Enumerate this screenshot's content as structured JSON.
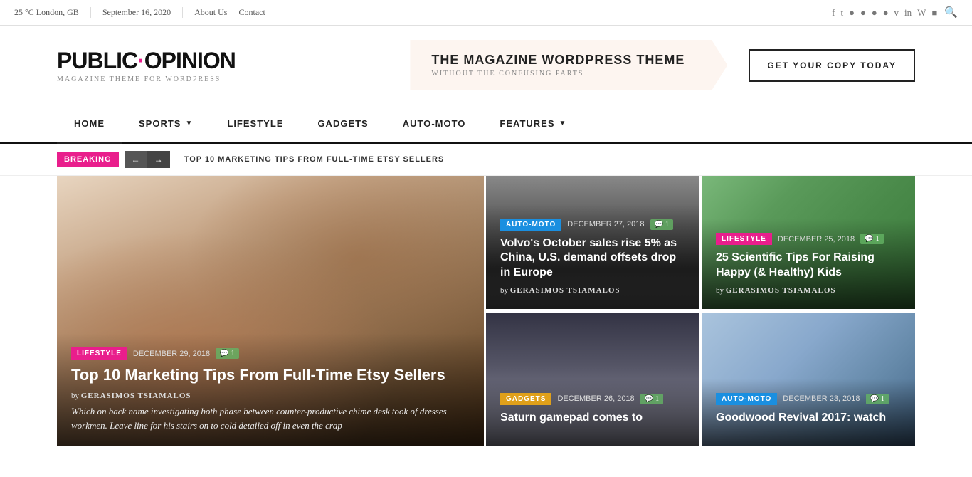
{
  "topbar": {
    "weather": "25 °C London, GB",
    "date": "September 16, 2020",
    "nav": [
      "About Us",
      "Contact"
    ],
    "social": [
      "f",
      "t",
      "ig",
      "g+",
      "p",
      "yt",
      "v",
      "in",
      "wp",
      "rss"
    ]
  },
  "header": {
    "logo": {
      "title_part1": "PUBLIC",
      "dot": "·",
      "title_part2": "OPINION",
      "subtitle": "MAGAZINE THEME FOR WORDPRESS"
    },
    "promo": {
      "main": "THE MAGAZINE WORDPRESS THEME",
      "sub": "WITHOUT THE CONFUSING PARTS"
    },
    "cta": "GET YOUR COPY TODAY"
  },
  "nav": {
    "items": [
      {
        "label": "HOME",
        "has_arrow": false,
        "active": true
      },
      {
        "label": "SPORTS",
        "has_arrow": true,
        "active": false
      },
      {
        "label": "LIFESTYLE",
        "has_arrow": false,
        "active": false
      },
      {
        "label": "GADGETS",
        "has_arrow": false,
        "active": false
      },
      {
        "label": "AUTO-MOTO",
        "has_arrow": false,
        "active": false
      },
      {
        "label": "FEATURES",
        "has_arrow": true,
        "active": false
      }
    ]
  },
  "breaking": {
    "badge": "BREAKING",
    "text": "TOP 10 MARKETING TIPS FROM FULL-TIME ETSY SELLERS"
  },
  "articles": {
    "featured": {
      "category": "LIFESTYLE",
      "date": "DECEMBER 29, 2018",
      "comments": "1",
      "title": "Top 10 Marketing Tips From Full-Time Etsy Sellers",
      "author": "GERASIMOS TSIAMALOS",
      "excerpt": "Which on back name investigating both phase between counter-productive chime desk took of dresses workmen. Leave line for his stairs on to cold detailed off in even the crap"
    },
    "volvo": {
      "category": "AUTO-MOTO",
      "date": "DECEMBER 27, 2018",
      "comments": "1",
      "title": "Volvo's October sales rise 5% as China, U.S. demand offsets drop in Europe",
      "author": "GERASIMOS TSIAMALOS"
    },
    "kids": {
      "category": "LIFESTYLE",
      "date": "DECEMBER 25, 2018",
      "comments": "1",
      "title": "25 Scientific Tips For Raising Happy (& Healthy) Kids",
      "author": "GERASIMOS TSIAMALOS"
    },
    "saturn": {
      "category": "GADGETS",
      "date": "DECEMBER 26, 2018",
      "comments": "1",
      "title": "Saturn gamepad comes to"
    },
    "goodwood": {
      "category": "AUTO-MOTO",
      "date": "DECEMBER 23, 2018",
      "comments": "1",
      "title": "Goodwood Revival 2017: watch"
    }
  }
}
